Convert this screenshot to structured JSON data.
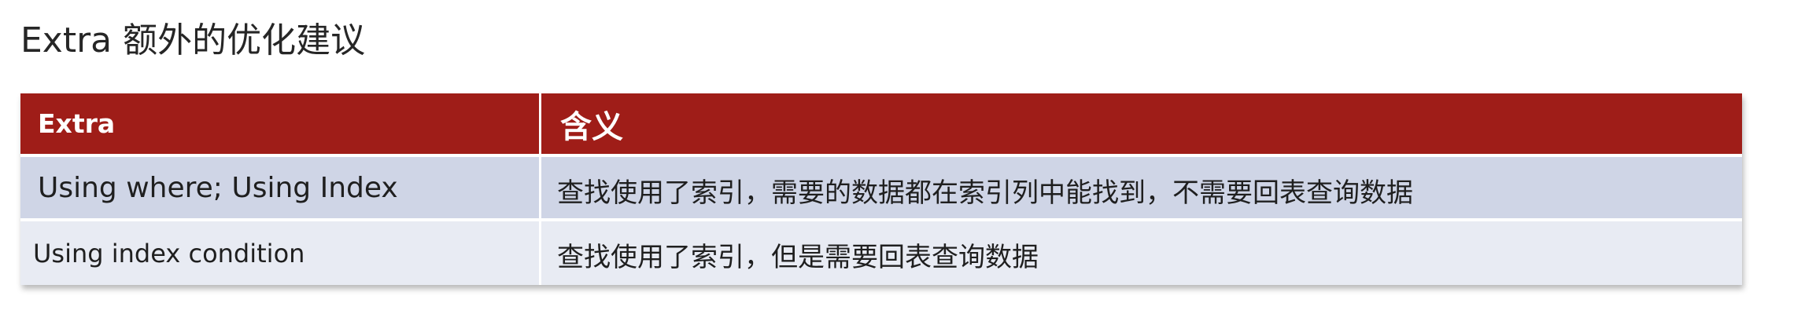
{
  "title": "Extra 额外的优化建议",
  "table": {
    "headers": [
      "Extra",
      "含义"
    ],
    "rows": [
      [
        "Using where; Using Index",
        "查找使用了索引，需要的数据都在索引列中能找到，不需要回表查询数据"
      ],
      [
        "Using index condition",
        "查找使用了索引，但是需要回表查询数据"
      ]
    ]
  },
  "colors": {
    "header_background": "#9f1d18",
    "header_text": "#ffffff",
    "row_1_background": "#cfd5e6",
    "row_2_background": "#e8ebf3"
  }
}
